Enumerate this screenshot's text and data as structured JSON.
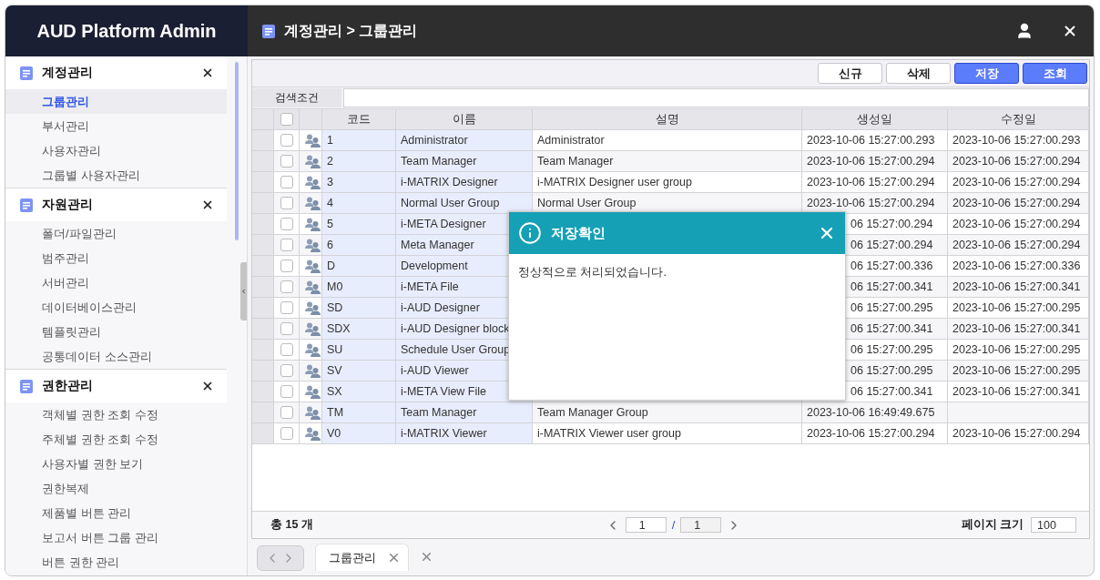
{
  "app": {
    "title": "AUD Platform Admin",
    "breadcrumb": "계정관리 > 그룹관리"
  },
  "sidebar": {
    "groups": [
      {
        "title": "계정관리",
        "items": [
          {
            "label": "그룹관리",
            "selected": true
          },
          {
            "label": "부서관리",
            "selected": false
          },
          {
            "label": "사용자관리",
            "selected": false
          },
          {
            "label": "그룹별 사용자관리",
            "selected": false
          }
        ]
      },
      {
        "title": "자원관리",
        "items": [
          {
            "label": "폴더/파일관리",
            "selected": false
          },
          {
            "label": "범주관리",
            "selected": false
          },
          {
            "label": "서버관리",
            "selected": false
          },
          {
            "label": "데이터베이스관리",
            "selected": false
          },
          {
            "label": "템플릿관리",
            "selected": false
          },
          {
            "label": "공통데이터 소스관리",
            "selected": false
          }
        ]
      },
      {
        "title": "권한관리",
        "items": [
          {
            "label": "객체별 권한 조회 수정",
            "selected": false
          },
          {
            "label": "주체별 권한 조회 수정",
            "selected": false
          },
          {
            "label": "사용자별 권한 보기",
            "selected": false
          },
          {
            "label": "권한복제",
            "selected": false
          },
          {
            "label": "제품별 버튼 관리",
            "selected": false
          },
          {
            "label": "보고서 버튼 그룹 관리",
            "selected": false
          },
          {
            "label": "버튼 권한 관리",
            "selected": false
          }
        ]
      }
    ]
  },
  "toolbar": {
    "buttons": [
      {
        "label": "신규",
        "kind": "normal"
      },
      {
        "label": "삭제",
        "kind": "normal"
      },
      {
        "label": "저장",
        "kind": "primary"
      },
      {
        "label": "조회",
        "kind": "primary"
      }
    ]
  },
  "search": {
    "label": "검색조건"
  },
  "grid": {
    "columns": [
      "코드",
      "이름",
      "설명",
      "생성일",
      "수정일"
    ],
    "all_checked": false,
    "rows": [
      {
        "code": "1",
        "name": "Administrator",
        "desc": "Administrator",
        "created": "2023-10-06 15:27:00.293",
        "updated": "2023-10-06 15:27:00.293",
        "checked": false,
        "covered": false
      },
      {
        "code": "2",
        "name": "Team Manager",
        "desc": "Team Manager",
        "created": "2023-10-06 15:27:00.294",
        "updated": "2023-10-06 15:27:00.294",
        "checked": false,
        "covered": false
      },
      {
        "code": "3",
        "name": "i-MATRIX Designer",
        "desc": "i-MATRIX Designer user group",
        "created": "2023-10-06 15:27:00.294",
        "updated": "2023-10-06 15:27:00.294",
        "checked": false,
        "covered": false
      },
      {
        "code": "4",
        "name": "Normal User Group",
        "desc": "Normal User Group",
        "created": "2023-10-06 15:27:00.294",
        "updated": "2023-10-06 15:27:00.294",
        "checked": false,
        "covered": false
      },
      {
        "code": "5",
        "name": "i-META Designer",
        "created": "06 15:27:00.294",
        "updated": "2023-10-06 15:27:00.294",
        "checked": false,
        "covered": true
      },
      {
        "code": "6",
        "name": "Meta Manager",
        "created": "06 15:27:00.294",
        "updated": "2023-10-06 15:27:00.294",
        "checked": false,
        "covered": true
      },
      {
        "code": "D",
        "name": "Development",
        "created": "06 15:27:00.336",
        "updated": "2023-10-06 15:27:00.336",
        "checked": false,
        "covered": true
      },
      {
        "code": "M0",
        "name": "i-META File",
        "created": "06 15:27:00.341",
        "updated": "2023-10-06 15:27:00.341",
        "checked": false,
        "covered": true
      },
      {
        "code": "SD",
        "name": "i-AUD Designer",
        "created": "06 15:27:00.295",
        "updated": "2023-10-06 15:27:00.295",
        "checked": false,
        "covered": true
      },
      {
        "code": "SDX",
        "name": "i-AUD Designer block",
        "created": "06 15:27:00.341",
        "updated": "2023-10-06 15:27:00.341",
        "checked": false,
        "covered": true
      },
      {
        "code": "SU",
        "name": "Schedule User Group",
        "created": "06 15:27:00.295",
        "updated": "2023-10-06 15:27:00.295",
        "checked": false,
        "covered": true
      },
      {
        "code": "SV",
        "name": "i-AUD Viewer",
        "created": "06 15:27:00.295",
        "updated": "2023-10-06 15:27:00.295",
        "checked": false,
        "covered": true
      },
      {
        "code": "SX",
        "name": "i-META View File",
        "created": "06 15:27:00.341",
        "updated": "2023-10-06 15:27:00.341",
        "checked": false,
        "covered": true
      },
      {
        "code": "TM",
        "name": "Team Manager",
        "desc": "Team Manager Group",
        "created": "2023-10-06 16:49:49.675",
        "checked": false,
        "covered": false
      },
      {
        "code": "V0",
        "name": "i-MATRIX Viewer",
        "desc": "i-MATRIX Viewer user group",
        "created": "2023-10-06 15:27:00.294",
        "updated": "2023-10-06 15:27:00.294",
        "checked": false,
        "covered": false
      }
    ]
  },
  "footer": {
    "total": "총 15 개",
    "page": "1",
    "separator": "/",
    "pages": "1",
    "page_size_label": "페이지 크기",
    "page_size": "100"
  },
  "tabs": [
    {
      "label": "그룹관리",
      "selected": true
    }
  ],
  "dialog": {
    "title": "저장확인",
    "message": "정상적으로 처리되었습니다."
  }
}
